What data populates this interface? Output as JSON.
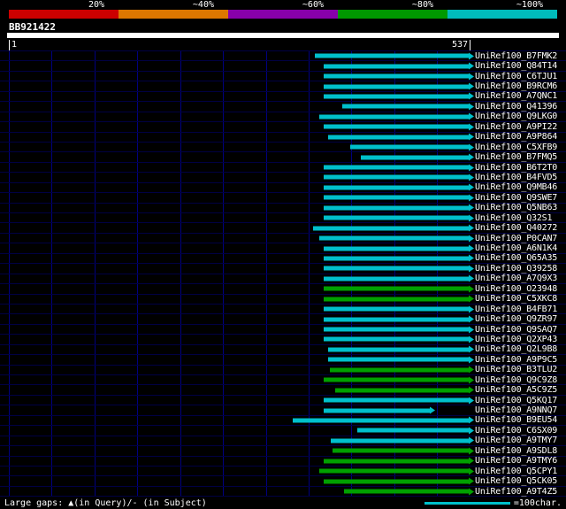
{
  "header": {
    "scale_labels": [
      "20%",
      "~40%",
      "~60%",
      "~80%",
      "~100%"
    ],
    "scale_segments": [
      {
        "tier": "20",
        "color": "#cc0000"
      },
      {
        "tier": "40",
        "color": "#dd7700"
      },
      {
        "tier": "60",
        "color": "#8800aa"
      },
      {
        "tier": "80",
        "color": "#009900"
      },
      {
        "tier": "100",
        "color": "#00bbbb"
      }
    ],
    "query_name": "BB921422",
    "ruler_start": "1",
    "ruler_end": "537"
  },
  "footer": {
    "gaps_label": "Large gaps: ▲(in Query)/- (in Subject)",
    "scale_label": "=100char.",
    "scale_chars": 100
  },
  "colors": {
    "background": "#000000",
    "text": "#ffffff",
    "grid_vertical": "#000080",
    "grid_horizontal": "#000044",
    "query_bar": "#ffffff",
    "bar_cyan": "#00c0cc",
    "bar_green": "#00a000"
  },
  "plot": {
    "gridline_interval": 50
  },
  "chart_data": {
    "type": "bar",
    "title": "BB921422",
    "query_length": 537,
    "x_axis": {
      "start": 1,
      "end": 537
    },
    "identity_colors": {
      "cyan": "~100%",
      "green": "~80%"
    },
    "hits": [
      {
        "label": "UniRef100_B7FMK2",
        "start": 358,
        "end": 537,
        "color": "cyan"
      },
      {
        "label": "UniRef100_Q84T14",
        "start": 369,
        "end": 537,
        "color": "cyan"
      },
      {
        "label": "UniRef100_C6TJU1",
        "start": 369,
        "end": 537,
        "color": "cyan"
      },
      {
        "label": "UniRef100_B9RCM6",
        "start": 369,
        "end": 537,
        "color": "cyan"
      },
      {
        "label": "UniRef100_A7QNC1",
        "start": 369,
        "end": 537,
        "color": "cyan"
      },
      {
        "label": "UniRef100_Q41396",
        "start": 390,
        "end": 537,
        "color": "cyan"
      },
      {
        "label": "UniRef100_Q9LKG0",
        "start": 363,
        "end": 537,
        "color": "cyan"
      },
      {
        "label": "UniRef100_A9PI22",
        "start": 369,
        "end": 537,
        "color": "cyan"
      },
      {
        "label": "UniRef100_A9P864",
        "start": 374,
        "end": 537,
        "color": "cyan"
      },
      {
        "label": "UniRef100_C5XFB9",
        "start": 400,
        "end": 537,
        "color": "cyan"
      },
      {
        "label": "UniRef100_B7FMQ5",
        "start": 412,
        "end": 537,
        "color": "cyan"
      },
      {
        "label": "UniRef100_B6T2T0",
        "start": 369,
        "end": 537,
        "color": "cyan"
      },
      {
        "label": "UniRef100_B4FVD5",
        "start": 369,
        "end": 537,
        "color": "cyan"
      },
      {
        "label": "UniRef100_Q9MB46",
        "start": 369,
        "end": 537,
        "color": "cyan"
      },
      {
        "label": "UniRef100_Q9SWE7",
        "start": 369,
        "end": 537,
        "color": "cyan"
      },
      {
        "label": "UniRef100_Q5NB63",
        "start": 369,
        "end": 537,
        "color": "cyan"
      },
      {
        "label": "UniRef100_Q32S1",
        "start": 369,
        "end": 537,
        "color": "cyan"
      },
      {
        "label": "UniRef100_Q40272",
        "start": 356,
        "end": 537,
        "color": "cyan"
      },
      {
        "label": "UniRef100_P0CAN7",
        "start": 363,
        "end": 537,
        "color": "cyan"
      },
      {
        "label": "UniRef100_A6N1K4",
        "start": 369,
        "end": 537,
        "color": "cyan"
      },
      {
        "label": "UniRef100_Q65A35",
        "start": 369,
        "end": 537,
        "color": "cyan"
      },
      {
        "label": "UniRef100_Q39258",
        "start": 369,
        "end": 537,
        "color": "cyan"
      },
      {
        "label": "UniRef100_A7Q9X3",
        "start": 369,
        "end": 537,
        "color": "cyan"
      },
      {
        "label": "UniRef100_O23948",
        "start": 369,
        "end": 537,
        "color": "green"
      },
      {
        "label": "UniRef100_C5XKC8",
        "start": 369,
        "end": 537,
        "color": "green"
      },
      {
        "label": "UniRef100_B4FB71",
        "start": 369,
        "end": 537,
        "color": "cyan"
      },
      {
        "label": "UniRef100_Q9ZR97",
        "start": 369,
        "end": 537,
        "color": "cyan"
      },
      {
        "label": "UniRef100_Q9SAQ7",
        "start": 369,
        "end": 537,
        "color": "cyan"
      },
      {
        "label": "UniRef100_Q2XP43",
        "start": 369,
        "end": 537,
        "color": "cyan"
      },
      {
        "label": "UniRef100_Q2L9B8",
        "start": 374,
        "end": 537,
        "color": "cyan"
      },
      {
        "label": "UniRef100_A9P9C5",
        "start": 374,
        "end": 537,
        "color": "cyan"
      },
      {
        "label": "UniRef100_B3TLU2",
        "start": 376,
        "end": 537,
        "color": "green"
      },
      {
        "label": "UniRef100_Q9C9Z8",
        "start": 369,
        "end": 537,
        "color": "green"
      },
      {
        "label": "UniRef100_A5C9Z5",
        "start": 382,
        "end": 537,
        "color": "green"
      },
      {
        "label": "UniRef100_Q5KQ17",
        "start": 369,
        "end": 537,
        "color": "cyan"
      },
      {
        "label": "UniRef100_A9NNQ7",
        "start": 369,
        "end": 492,
        "color": "cyan"
      },
      {
        "label": "UniRef100_B9EU54",
        "start": 333,
        "end": 537,
        "color": "cyan"
      },
      {
        "label": "UniRef100_C6SX09",
        "start": 408,
        "end": 537,
        "color": "cyan"
      },
      {
        "label": "UniRef100_A9TMY7",
        "start": 377,
        "end": 537,
        "color": "cyan"
      },
      {
        "label": "UniRef100_A9SDL8",
        "start": 379,
        "end": 537,
        "color": "green"
      },
      {
        "label": "UniRef100_A9TMY6",
        "start": 369,
        "end": 537,
        "color": "green"
      },
      {
        "label": "UniRef100_Q5CPY1",
        "start": 363,
        "end": 537,
        "color": "green"
      },
      {
        "label": "UniRef100_Q5CK05",
        "start": 369,
        "end": 537,
        "color": "green"
      },
      {
        "label": "UniRef100_A9T4Z5",
        "start": 392,
        "end": 537,
        "color": "green"
      }
    ]
  }
}
